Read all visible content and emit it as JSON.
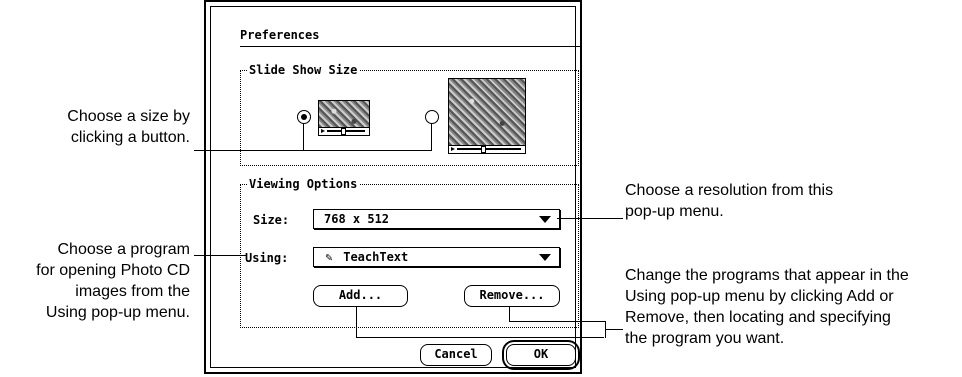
{
  "dialog": {
    "title": "Preferences",
    "slide_show_group": {
      "label": "Slide Show Size"
    },
    "viewing_group": {
      "label": "Viewing Options",
      "size_label": "Size:",
      "size_value": "768 x 512",
      "using_label": "Using:",
      "using_value": "TeachText"
    },
    "buttons": {
      "add": "Add...",
      "remove": "Remove...",
      "cancel": "Cancel",
      "ok": "OK"
    }
  },
  "callouts": {
    "size": [
      "Choose a size by",
      "clicking a button."
    ],
    "program": [
      "Choose a program",
      "for opening Photo CD",
      "images from the",
      "Using pop-up menu."
    ],
    "resolution": [
      "Choose a resolution from this",
      "pop-up menu."
    ],
    "change": [
      "Change the programs that appear in the",
      "Using pop-up menu by clicking Add or",
      "Remove, then locating and specifying",
      "the program you want."
    ]
  }
}
